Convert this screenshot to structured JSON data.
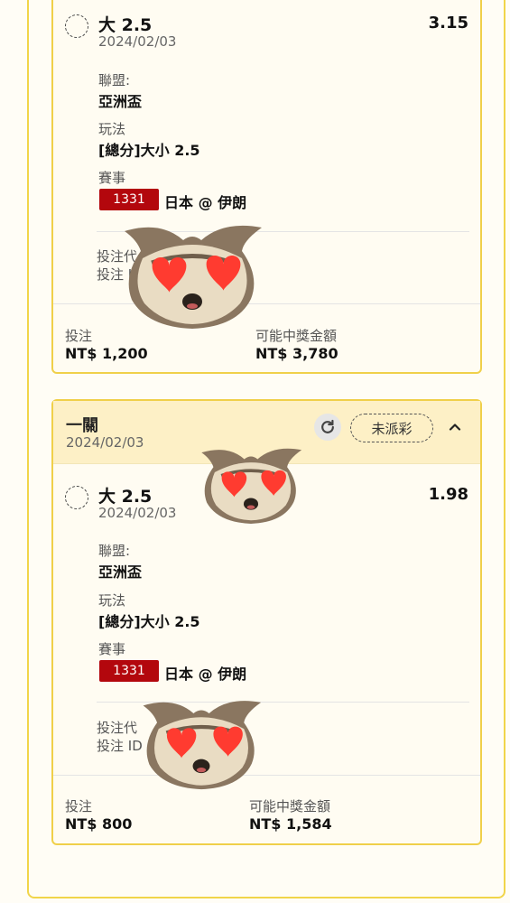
{
  "bets": [
    {
      "selection": {
        "title": "大 2.5",
        "date": "2024/02/03",
        "odds": "3.15"
      },
      "league": {
        "label": "聯盟:",
        "value": "亞洲盃"
      },
      "market": {
        "label": "玩法",
        "value": "[總分]大小 2.5"
      },
      "event": {
        "label": "賽事",
        "match_id": "1331",
        "teams": "日本 @ 伊朗"
      },
      "bet_code": {
        "line1": "投注代",
        "line2": "投注 I"
      },
      "stake": {
        "label": "投注",
        "value": "NT$ 1,200"
      },
      "payout": {
        "label": "可能中獎金額",
        "value": "NT$ 3,780"
      }
    },
    {
      "header": {
        "title": "一關",
        "date": "2024/02/03",
        "status": "未派彩"
      },
      "selection": {
        "title": "大 2.5",
        "date": "2024/02/03",
        "odds": "1.98"
      },
      "league": {
        "label": "聯盟:",
        "value": "亞洲盃"
      },
      "market": {
        "label": "玩法",
        "value": "[總分]大小 2.5"
      },
      "event": {
        "label": "賽事",
        "match_id": "1331",
        "teams": "日本 @ 伊朗"
      },
      "bet_code": {
        "line1": "投注代",
        "line2": "投注 ID"
      },
      "stake": {
        "label": "投注",
        "value": "NT$ 800"
      },
      "payout": {
        "label": "可能中獎金額",
        "value": "NT$ 1,584"
      }
    }
  ],
  "icons": {
    "refresh": "refresh-icon",
    "collapse": "chevron-up-icon",
    "selection": "dashed-circle-icon",
    "sticker": "heart-eyes-owl-sticker"
  },
  "colors": {
    "card_border": "#f0d04a",
    "header_bg": "#fdf0c6",
    "match_badge": "#b3070d"
  }
}
